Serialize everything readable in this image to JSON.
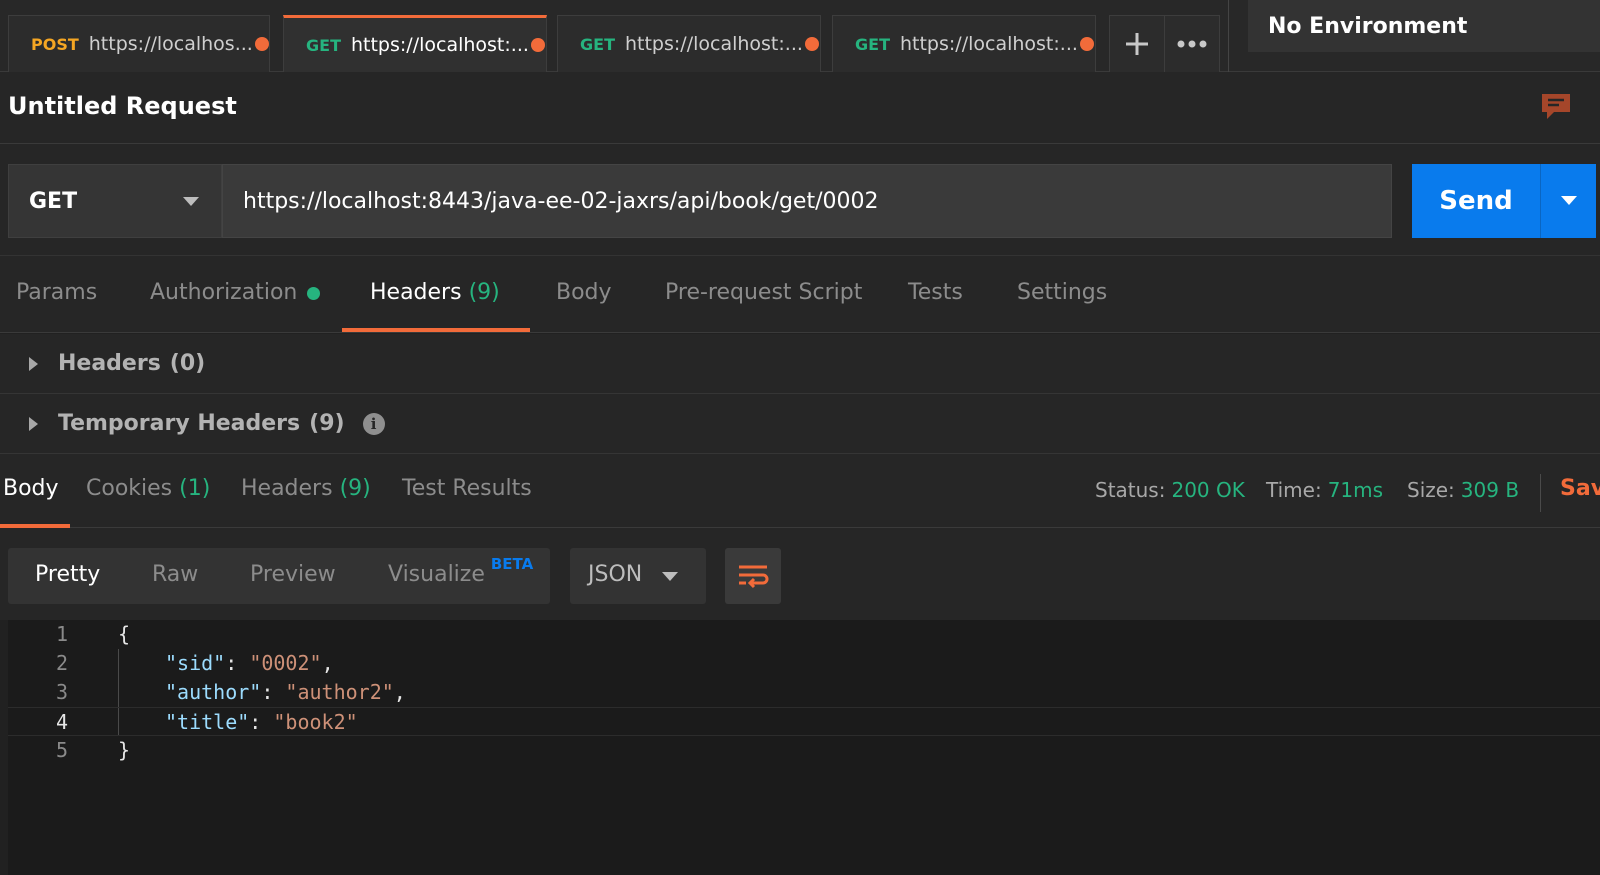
{
  "tabs": [
    {
      "method": "POST",
      "url": "https://localhos...",
      "method_color": "#f5a623"
    },
    {
      "method": "GET",
      "url": "https://localhost:...",
      "method_color": "#26b47f",
      "active": true
    },
    {
      "method": "GET",
      "url": "https://localhost:...",
      "method_color": "#26b47f"
    },
    {
      "method": "GET",
      "url": "https://localhost:...",
      "method_color": "#26b47f"
    }
  ],
  "tab_actions": {
    "new_tab_icon": "plus-icon",
    "more_icon": "ellipsis-icon"
  },
  "environment": {
    "label": "No Environment"
  },
  "request": {
    "title": "Untitled Request",
    "method": "GET",
    "url": "https://localhost:8443/java-ee-02-jaxrs/api/book/get/0002",
    "send_label": "Send"
  },
  "request_tabs": {
    "params": "Params",
    "authorization": "Authorization",
    "headers": "Headers",
    "headers_count": "(9)",
    "body": "Body",
    "pre_request": "Pre-request Script",
    "tests": "Tests",
    "settings": "Settings"
  },
  "header_sections": {
    "headers": "Headers",
    "headers_count": "(0)",
    "temporary": "Temporary Headers",
    "temporary_count": "(9)"
  },
  "response_tabs": {
    "body": "Body",
    "cookies": "Cookies",
    "cookies_count": "(1)",
    "headers": "Headers",
    "headers_count": "(9)",
    "test_results": "Test Results"
  },
  "response_status": {
    "status_label": "Status:",
    "status_value": "200 OK",
    "time_label": "Time:",
    "time_value": "71ms",
    "size_label": "Size:",
    "size_value": "309 B",
    "save_label": "Sav"
  },
  "view_modes": {
    "pretty": "Pretty",
    "raw": "Raw",
    "preview": "Preview",
    "visualize": "Visualize",
    "beta": "BETA",
    "format": "JSON"
  },
  "code": {
    "line_numbers": [
      "1",
      "2",
      "3",
      "4",
      "5"
    ],
    "open_brace": "{",
    "close_brace": "}",
    "pairs": [
      {
        "key": "\"sid\"",
        "value": "\"0002\"",
        "comma": ","
      },
      {
        "key": "\"author\"",
        "value": "\"author2\"",
        "comma": ","
      },
      {
        "key": "\"title\"",
        "value": "\"book2\"",
        "comma": ""
      }
    ]
  },
  "colors": {
    "accent": "#f26b3a",
    "send_blue": "#097bed",
    "success_green": "#26b47f"
  }
}
